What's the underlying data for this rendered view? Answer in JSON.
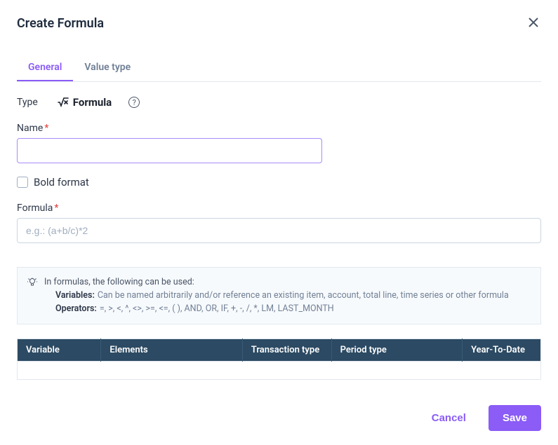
{
  "modal": {
    "title": "Create Formula"
  },
  "tabs": {
    "general": "General",
    "valueType": "Value type"
  },
  "type": {
    "label": "Type",
    "value": "Formula"
  },
  "name": {
    "label": "Name",
    "value": ""
  },
  "boldFormat": {
    "label": "Bold format"
  },
  "formula": {
    "label": "Formula",
    "placeholder": "e.g.: (a+b/c)*2",
    "value": ""
  },
  "hint": {
    "intro": "In formulas, the following can be used:",
    "variablesLabel": "Variables:",
    "variablesText": "Can be named arbitrarily and/or reference an existing item, account, total line, time series or other formula",
    "operatorsLabel": "Operators:",
    "operatorsText": "=, >, <, ^, <>, >=, <=, ( ), AND, OR, IF, +, -, /, *, LM, LAST_MONTH"
  },
  "table": {
    "headers": [
      "Variable",
      "Elements",
      "Transaction type",
      "Period type",
      "Year-To-Date"
    ]
  },
  "buttons": {
    "cancel": "Cancel",
    "save": "Save"
  }
}
